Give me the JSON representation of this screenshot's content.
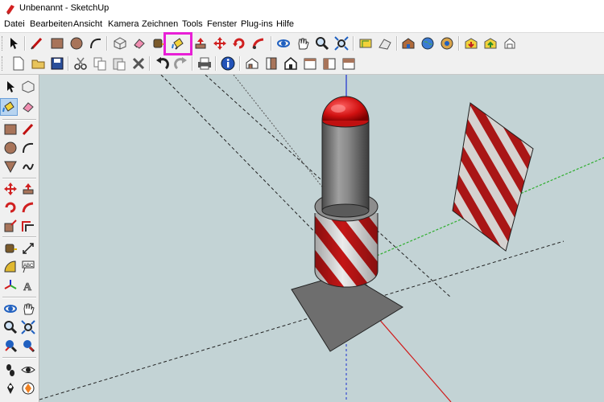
{
  "window": {
    "title": "Unbenannt - SketchUp"
  },
  "menu": [
    "Datei",
    "Bearbeiten",
    "Ansicht",
    "Kamera",
    "Zeichnen",
    "Tools",
    "Fenster",
    "Plug-ins",
    "Hilfe"
  ],
  "toolbar1": [
    "select-tool",
    "line-tool",
    "rectangle-tool",
    "circle-tool",
    "arc-tool",
    "component-tool",
    "eraser-tool",
    "tape-measure-tool",
    "paint-bucket-tool",
    "push-pull-tool",
    "move-tool",
    "rotate-tool",
    "follow-me-tool",
    "orbit-tool",
    "pan-tool",
    "zoom-tool",
    "zoom-extents-tool",
    "add-location-tool",
    "terrain-tool",
    "3d-warehouse-tool",
    "google-earth-tool",
    "share-component-tool",
    "get-models-tool",
    "share-model-tool"
  ],
  "toolbar2": [
    "new-file",
    "open-file",
    "save-file",
    "cut",
    "copy",
    "paste",
    "delete",
    "undo",
    "redo",
    "print",
    "model-info",
    "iso-view",
    "front-view",
    "top-view",
    "right-view",
    "back-view",
    "left-view"
  ],
  "highlighted_tool": "paint-bucket-tool",
  "colors": {
    "highlight": "#e81fd6",
    "viewport_bg": "#c3d3d5",
    "stripe_red": "#c01818",
    "axis_green": "#2fae2f",
    "axis_red": "#d01a1a",
    "axis_blue": "#1a2fd0"
  }
}
